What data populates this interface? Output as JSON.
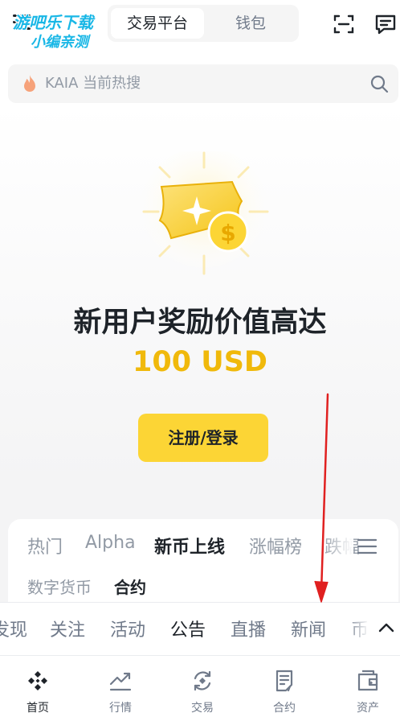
{
  "watermark": {
    "line1": "游吧乐下载",
    "line2": "小编亲测"
  },
  "header": {
    "tabs": [
      {
        "label": "交易平台",
        "active": true
      },
      {
        "label": "钱包",
        "active": false
      }
    ]
  },
  "search": {
    "placeholder": "KAIA 当前热搜"
  },
  "hero": {
    "title": "新用户奖励价值高达",
    "amount": "100 USD",
    "cta_label": "注册/登录"
  },
  "market": {
    "tabs": [
      {
        "label": "热门",
        "active": false
      },
      {
        "label": "Alpha",
        "active": false
      },
      {
        "label": "新币上线",
        "active": true
      },
      {
        "label": "涨幅榜",
        "active": false
      },
      {
        "label": "跌幅",
        "active": false
      }
    ],
    "subtabs": [
      {
        "label": "数字货币",
        "active": false
      },
      {
        "label": "合约",
        "active": true
      }
    ]
  },
  "feed": {
    "tabs": [
      {
        "label": "发现",
        "active": false
      },
      {
        "label": "关注",
        "active": false
      },
      {
        "label": "活动",
        "active": false
      },
      {
        "label": "公告",
        "active": true
      },
      {
        "label": "直播",
        "active": false
      },
      {
        "label": "新闻",
        "active": false
      },
      {
        "label": "币",
        "active": false
      }
    ]
  },
  "bottom_nav": [
    {
      "label": "首页",
      "icon": "home-logo-icon",
      "active": true
    },
    {
      "label": "行情",
      "icon": "trend-chart-icon",
      "active": false
    },
    {
      "label": "交易",
      "icon": "exchange-icon",
      "active": false
    },
    {
      "label": "合约",
      "icon": "contract-document-icon",
      "active": false
    },
    {
      "label": "资产",
      "icon": "wallet-icon",
      "active": false
    }
  ],
  "colors": {
    "brand_yellow": "#fcd535",
    "amount_gold": "#f0b90b",
    "text_primary": "#1e2329",
    "text_secondary": "#929aa5",
    "annotation_red": "#e02020"
  }
}
